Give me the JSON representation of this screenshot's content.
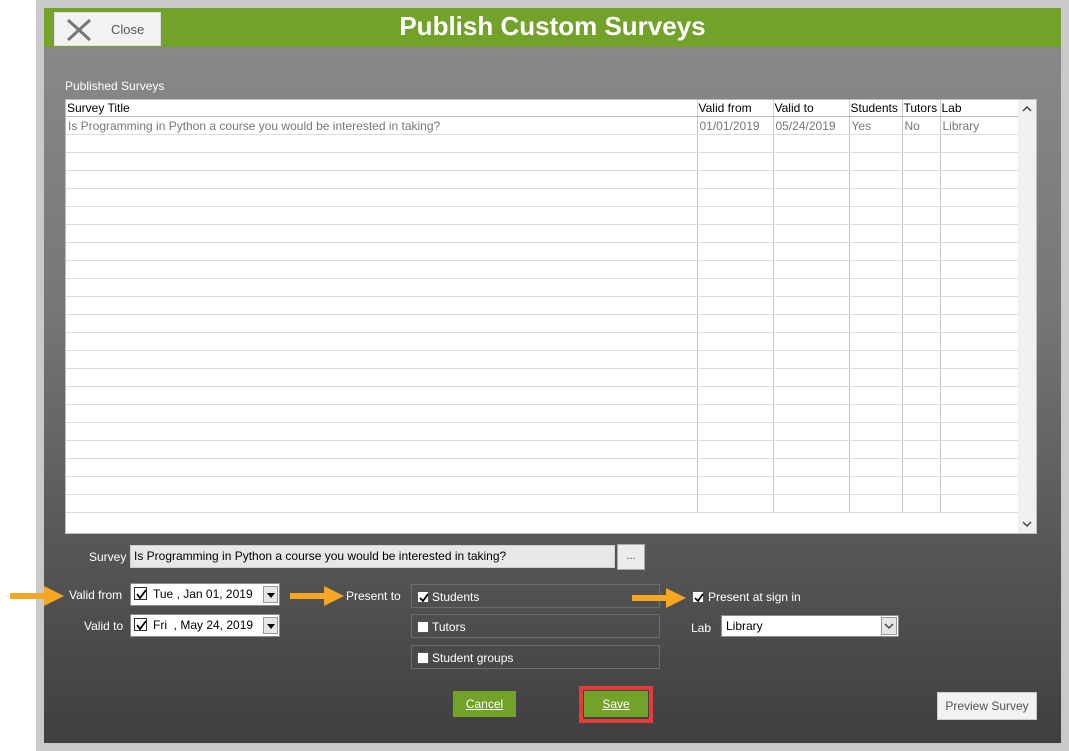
{
  "window": {
    "title": "Publish Custom Surveys",
    "close_label": "Close"
  },
  "grid": {
    "label": "Published Surveys",
    "columns": [
      "Survey Title",
      "Valid from",
      "Valid to",
      "Students",
      "Tutors",
      "Lab"
    ],
    "rows": [
      [
        "Is Programming in Python a course you would be interested in taking?",
        "01/01/2019",
        "05/24/2019",
        "Yes",
        "No",
        "Library"
      ]
    ]
  },
  "form": {
    "survey_title_label": "Survey Title",
    "survey_title_value": "Is Programming in Python a course you would be interested in taking?",
    "ellipsis_label": "...",
    "valid_from_label": "Valid from",
    "valid_from_value": "Tue , Jan 01, 2019",
    "valid_to_label": "Valid to",
    "valid_to_value": "Fri  , May 24, 2019",
    "present_to_label": "Present to",
    "present_options": [
      {
        "label": "Students",
        "checked": true
      },
      {
        "label": "Tutors",
        "checked": false
      },
      {
        "label": "Student groups",
        "checked": false
      }
    ],
    "present_at_signin_label": "Present at sign in",
    "present_at_signin_checked": true,
    "lab_label": "Lab",
    "lab_value": "Library"
  },
  "buttons": {
    "cancel": "Cancel",
    "save": "Save",
    "preview": "Preview Survey"
  },
  "colors": {
    "title_bar": "#73a22b",
    "highlight": "#e63b3b",
    "arrow": "#f5a623"
  }
}
